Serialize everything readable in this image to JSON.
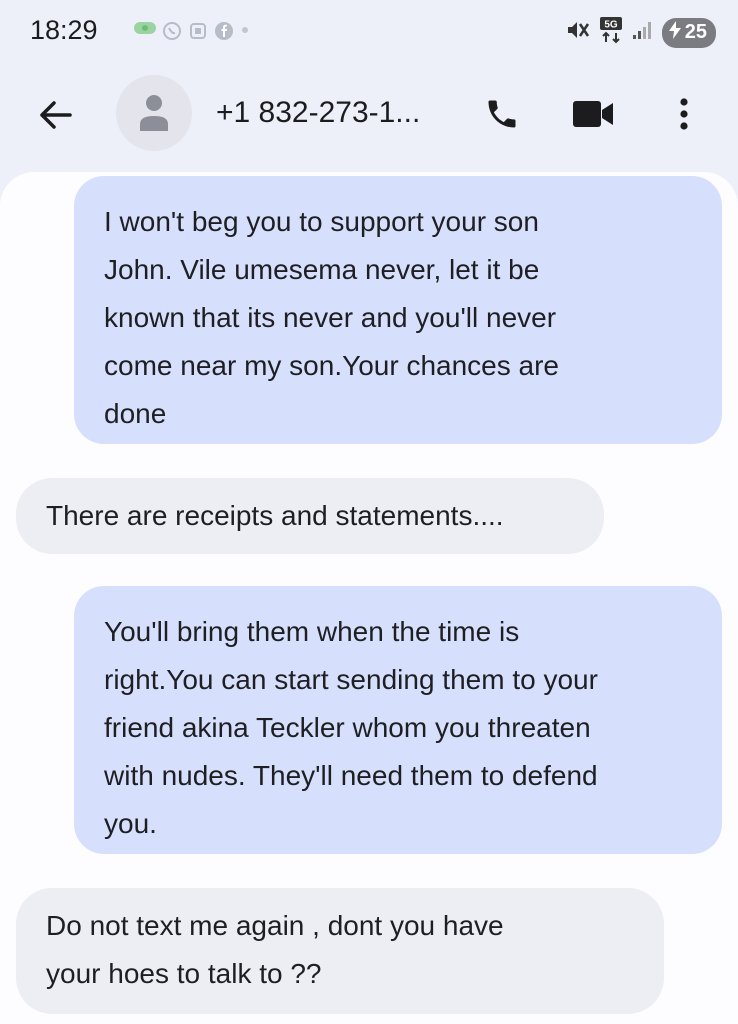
{
  "status_bar": {
    "time": "18:29",
    "battery_level": "25",
    "network": "5G"
  },
  "header": {
    "contact": "+1 832-273-1...",
    "icons": [
      "back-arrow-icon",
      "contact-avatar-icon",
      "phone-icon",
      "video-camera-icon",
      "more-vert-icon"
    ]
  },
  "messages": [
    {
      "direction": "outgoing",
      "lines": [
        "I won't beg you to support your son",
        "John. Vile umesema never, let it be",
        "known that its never and you'll never",
        "come near my son.Your chances are",
        "done"
      ]
    },
    {
      "direction": "incoming",
      "lines": [
        "There are receipts and statements...."
      ]
    },
    {
      "direction": "outgoing",
      "lines": [
        "You'll bring them when the time is",
        "right.You can start sending them to your",
        "friend akina Teckler whom you threaten",
        "with nudes. They'll need them to defend",
        "you."
      ]
    },
    {
      "direction": "incoming",
      "lines": [
        "Do not text me again , dont you have",
        "your hoes to talk to ??"
      ]
    }
  ],
  "colors": {
    "background": "#eef0f9",
    "chat_background": "#fdfdff",
    "outgoing_bubble": "#d6e0fc",
    "incoming_bubble": "#eceef3"
  }
}
